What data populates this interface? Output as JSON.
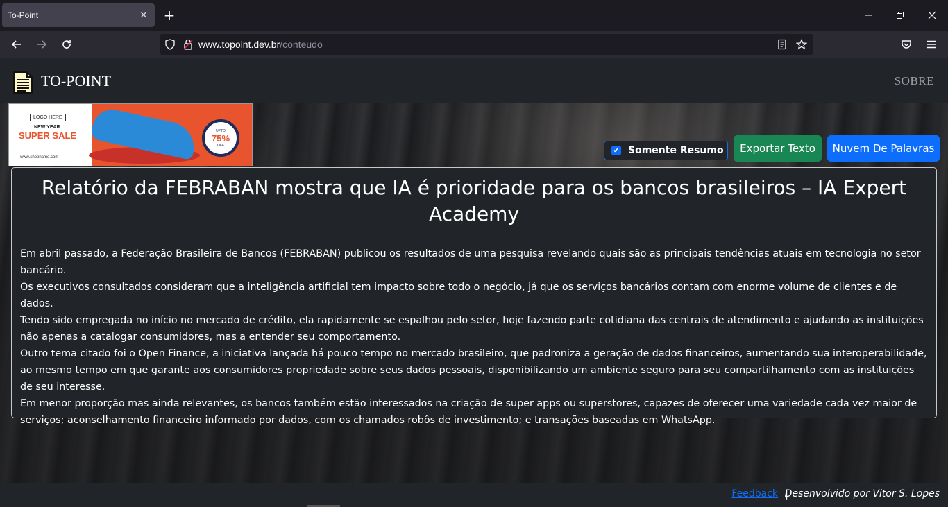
{
  "browser": {
    "tab_title": "To-Point",
    "tab_close": "✕",
    "new_tab": "+",
    "url_domain": "www.topoint.dev.br",
    "url_path": "/conteudo"
  },
  "site": {
    "brand": "TO-POINT",
    "nav_sobre": "SOBRE"
  },
  "ad": {
    "logo_here": "LOGO HERE",
    "new_year": "NEW YEAR",
    "super_sale": "SUPER SALE",
    "shop": "www.shopname.com",
    "upto": "UPTO",
    "percent": "75%",
    "off": "OFF"
  },
  "controls": {
    "summary_only_label": "Somente Resumo",
    "summary_only_checked": true,
    "export_label": "Exportar Texto",
    "wordcloud_label": "Nuvem De Palavras"
  },
  "article": {
    "title": "Relatório da FEBRABAN mostra que IA é prioridade para os bancos brasileiros – IA Expert Academy",
    "paragraphs": [
      "Em abril passado, a Federação Brasileira de Bancos (FEBRABAN) publicou os resultados de uma pesquisa revelando quais são as principais tendências atuais em tecnologia no setor bancário.",
      "Os executivos consultados consideram que a inteligência artificial tem impacto sobre todo o negócio, já que os serviços bancários contam com enorme volume de clientes e de dados.",
      "Tendo sido empregada no início no mercado de crédito, ela rapidamente se espalhou pelo setor, hoje fazendo parte cotidiana das centrais de atendimento e ajudando as instituições não apenas a catalogar consumidores, mas a entender seu comportamento.",
      "Outro tema citado foi o Open Finance, a iniciativa lançada há pouco tempo no mercado brasileiro, que padroniza a geração de dados financeiros, aumentando sua interoperabilidade, ao mesmo tempo em que garante aos consumidores propriedade sobre seus dados pessoais, disponibilizando um ambiente seguro para seu compartilhamento com as instituições de seu interesse.",
      "Em menor proporção mas ainda relevantes, os bancos também estão interessados na criação de super apps ou superstores, capazes de oferecer uma variedade cada vez maior de serviços; aconselhamento financeiro informado por dados, com os chamados robôs de investimento; e transações baseadas em WhatsApp."
    ]
  },
  "footer": {
    "feedback": "Feedback",
    "separator": "|",
    "developer": "Desenvolvido por Vitor S. Lopes"
  }
}
